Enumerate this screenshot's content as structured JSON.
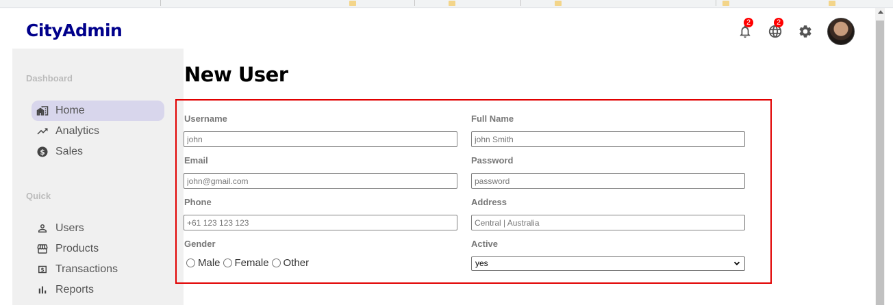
{
  "app": {
    "logo": "CityAdmin"
  },
  "header": {
    "notifications_count": "2",
    "language_count": "2",
    "icons": [
      "bell-icon",
      "globe-icon",
      "gear-icon",
      "avatar"
    ]
  },
  "sidebar": {
    "sections": [
      {
        "title": "Dashboard",
        "items": [
          {
            "label": "Home",
            "icon": "home-icon",
            "active": true
          },
          {
            "label": "Analytics",
            "icon": "trending-up-icon"
          },
          {
            "label": "Sales",
            "icon": "dollar-icon"
          }
        ]
      },
      {
        "title": "Quick",
        "items": [
          {
            "label": "Users",
            "icon": "user-icon"
          },
          {
            "label": "Products",
            "icon": "store-icon"
          },
          {
            "label": "Transactions",
            "icon": "money-icon"
          },
          {
            "label": "Reports",
            "icon": "bar-chart-icon"
          }
        ]
      }
    ]
  },
  "main": {
    "title": "New User",
    "form": {
      "username": {
        "label": "Username",
        "placeholder": "john"
      },
      "full_name": {
        "label": "Full Name",
        "placeholder": "john Smith"
      },
      "email": {
        "label": "Email",
        "placeholder": "john@gmail.com"
      },
      "password": {
        "label": "Password",
        "placeholder": "password"
      },
      "phone": {
        "label": "Phone",
        "placeholder": "+61 123 123 123"
      },
      "address": {
        "label": "Address",
        "placeholder": "Central | Australia"
      },
      "gender": {
        "label": "Gender",
        "options": [
          "Male",
          "Female",
          "Other"
        ]
      },
      "active": {
        "label": "Active",
        "value": "yes"
      }
    }
  },
  "colors": {
    "accent": "#00008b",
    "highlight_border": "#e10000",
    "badge": "#ff0000",
    "active_item_bg": "#d8d6ec"
  }
}
